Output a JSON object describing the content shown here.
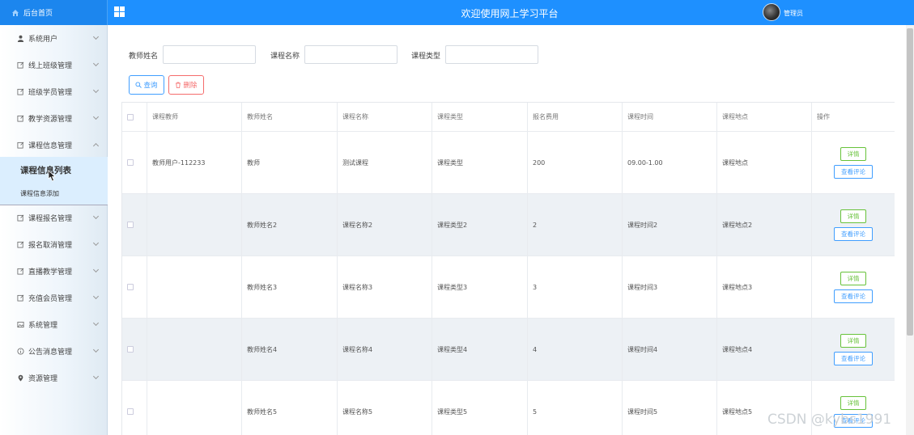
{
  "header": {
    "home_label": "后台首页",
    "title": "欢迎使用网上学习平台",
    "user": "管理员"
  },
  "sidebar": {
    "items": [
      {
        "label": "系统用户",
        "icon": "user-icon"
      },
      {
        "label": "线上班级管理",
        "icon": "edit-icon"
      },
      {
        "label": "班级学员管理",
        "icon": "edit-icon"
      },
      {
        "label": "教学资源管理",
        "icon": "edit-icon"
      },
      {
        "label": "课程信息管理",
        "icon": "edit-icon"
      },
      {
        "label": "课程报名管理",
        "icon": "edit-icon"
      },
      {
        "label": "报名取消管理",
        "icon": "edit-icon"
      },
      {
        "label": "直播教学管理",
        "icon": "edit-icon"
      },
      {
        "label": "充值会员管理",
        "icon": "edit-icon"
      },
      {
        "label": "系统管理",
        "icon": "image-icon"
      },
      {
        "label": "公告消息管理",
        "icon": "info-circle-icon"
      },
      {
        "label": "资源管理",
        "icon": "location-icon"
      }
    ],
    "sub_items": [
      "课程信息列表",
      "课程信息添加"
    ]
  },
  "search": {
    "teacher_label": "教师姓名",
    "teacher_value": "",
    "course_label": "课程名称",
    "course_value": "",
    "type_label": "课程类型",
    "type_value": "",
    "query_button": "查询",
    "delete_button": "删除"
  },
  "table": {
    "columns": [
      "课程教师",
      "教师姓名",
      "课程名称",
      "课程类型",
      "报名费用",
      "课程时间",
      "课程地点",
      "操作"
    ],
    "rows": [
      [
        "教师用户-112233",
        "教师",
        "测试课程",
        "课程类型",
        "200",
        "09.00-1.00",
        "课程地点"
      ],
      [
        "",
        "教师姓名2",
        "课程名称2",
        "课程类型2",
        "2",
        "课程时间2",
        "课程地点2"
      ],
      [
        "",
        "教师姓名3",
        "课程名称3",
        "课程类型3",
        "3",
        "课程时间3",
        "课程地点3"
      ],
      [
        "",
        "教师姓名4",
        "课程名称4",
        "课程类型4",
        "4",
        "课程时间4",
        "课程地点4"
      ],
      [
        "",
        "教师姓名5",
        "课程名称5",
        "课程类型5",
        "5",
        "课程时间5",
        "课程地点5"
      ]
    ],
    "detail_label": "详情",
    "comment_label": "查看评论"
  },
  "watermark": "CSDN @kybs1991",
  "colors": {
    "header_bg": "#1e90ff",
    "primary": "#409eff",
    "danger": "#f56c6c",
    "success": "#67c23a",
    "stripe": "#edf1f5"
  }
}
